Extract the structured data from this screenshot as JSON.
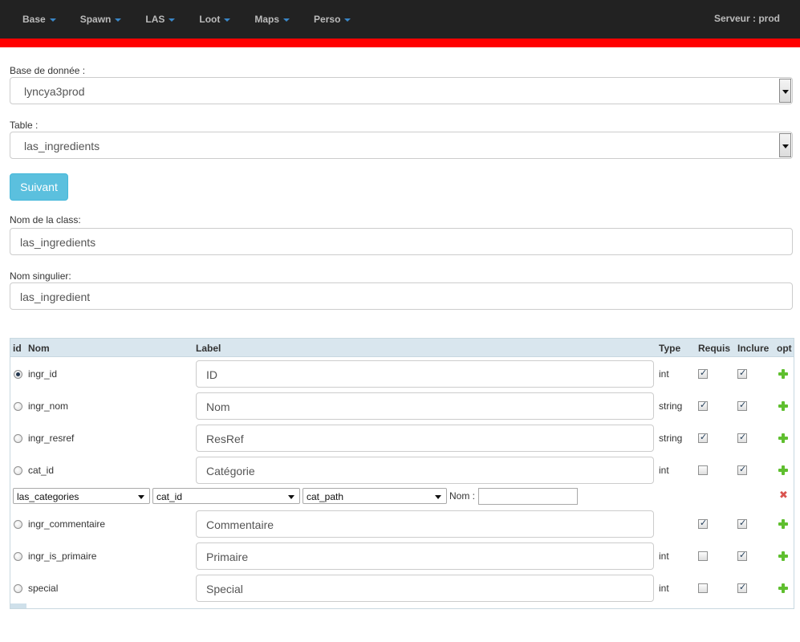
{
  "nav": {
    "items": [
      "Base",
      "Spawn",
      "LAS",
      "Loot",
      "Maps",
      "Perso"
    ],
    "server": "Serveur : prod"
  },
  "form": {
    "db_label": "Base de donnée :",
    "db_value": "lyncya3prod",
    "table_label": "Table :",
    "table_value": "las_ingredients",
    "next_button": "Suivant",
    "class_label": "Nom de la class:",
    "class_value": "las_ingredients",
    "singular_label": "Nom singulier:",
    "singular_value": "las_ingredient"
  },
  "grid": {
    "headers": {
      "id": "id",
      "nom": "Nom",
      "label": "Label",
      "type": "Type",
      "requis": "Requis",
      "inclure": "Inclure",
      "opt": "opt"
    },
    "rows": [
      {
        "name": "ingr_id",
        "label": "ID",
        "type": "int",
        "id_selected": true,
        "requis": true,
        "inclure": true
      },
      {
        "name": "ingr_nom",
        "label": "Nom",
        "type": "string",
        "id_selected": false,
        "requis": true,
        "inclure": true
      },
      {
        "name": "ingr_resref",
        "label": "ResRef",
        "type": "string",
        "id_selected": false,
        "requis": true,
        "inclure": true
      },
      {
        "name": "cat_id",
        "label": "Catégorie",
        "type": "int",
        "id_selected": false,
        "requis": false,
        "inclure": true
      },
      {
        "name": "ingr_commentaire",
        "label": "Commentaire",
        "type": "",
        "id_selected": false,
        "requis": true,
        "inclure": true
      },
      {
        "name": "ingr_is_primaire",
        "label": "Primaire",
        "type": "int",
        "id_selected": false,
        "requis": false,
        "inclure": true
      },
      {
        "name": "special",
        "label": "Special",
        "type": "int",
        "id_selected": false,
        "requis": false,
        "inclure": true
      }
    ],
    "relation": {
      "table": "las_categories",
      "key": "cat_id",
      "display": "cat_path",
      "nom_label": "Nom :",
      "nom_value": ""
    }
  },
  "icons": {
    "add": "plus-icon",
    "remove": "delete-icon",
    "menu_caret": "caret-down-icon"
  },
  "colors": {
    "navbar": "#222222",
    "accent_bar": "#ff0000",
    "next_button": "#5bc0de",
    "grid_header": "#d9e6ee",
    "add_icon": "#5fbf2f",
    "remove_icon": "#d9534f"
  }
}
